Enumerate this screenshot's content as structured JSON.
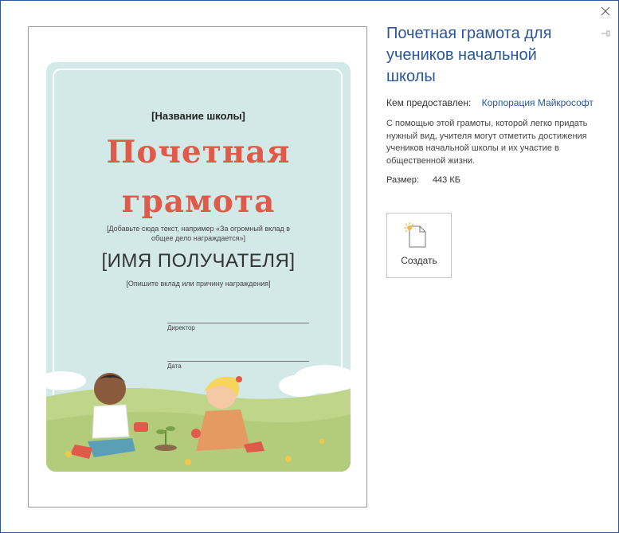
{
  "dialog": {
    "close_label": "✕",
    "pin_label": "⊣"
  },
  "preview": {
    "school_name": "[Название школы]",
    "title_line1": "Почетная",
    "title_line2": "грамота",
    "subtitle_line1": "[Добавьте сюда текст, например «За огромный вклад в",
    "subtitle_line2": "общее дело награждается»]",
    "recipient_name": "[ИМЯ ПОЛУЧАТЕЛЯ]",
    "reason": "[Опишите вклад или причину награждения]",
    "signature_director": "Директор",
    "signature_date": "Дата"
  },
  "template_info": {
    "title": "Почетная грамота для учеников начальной школы",
    "provided_by_label": "Кем предоставлен:",
    "provided_by_value": "Корпорация Майкрософт",
    "description": "С помощью этой грамоты, которой легко придать нужный вид, учителя могут отметить достижения учеников начальной школы и их участие в общественной жизни.",
    "size_label": "Размер:",
    "size_value": "443 КБ"
  },
  "create_button": {
    "label": "Создать"
  },
  "colors": {
    "accent": "#2b579a",
    "title_red": "#e05a4a",
    "certificate_bg": "#d3e9e8",
    "grass": "#bfd68a"
  }
}
